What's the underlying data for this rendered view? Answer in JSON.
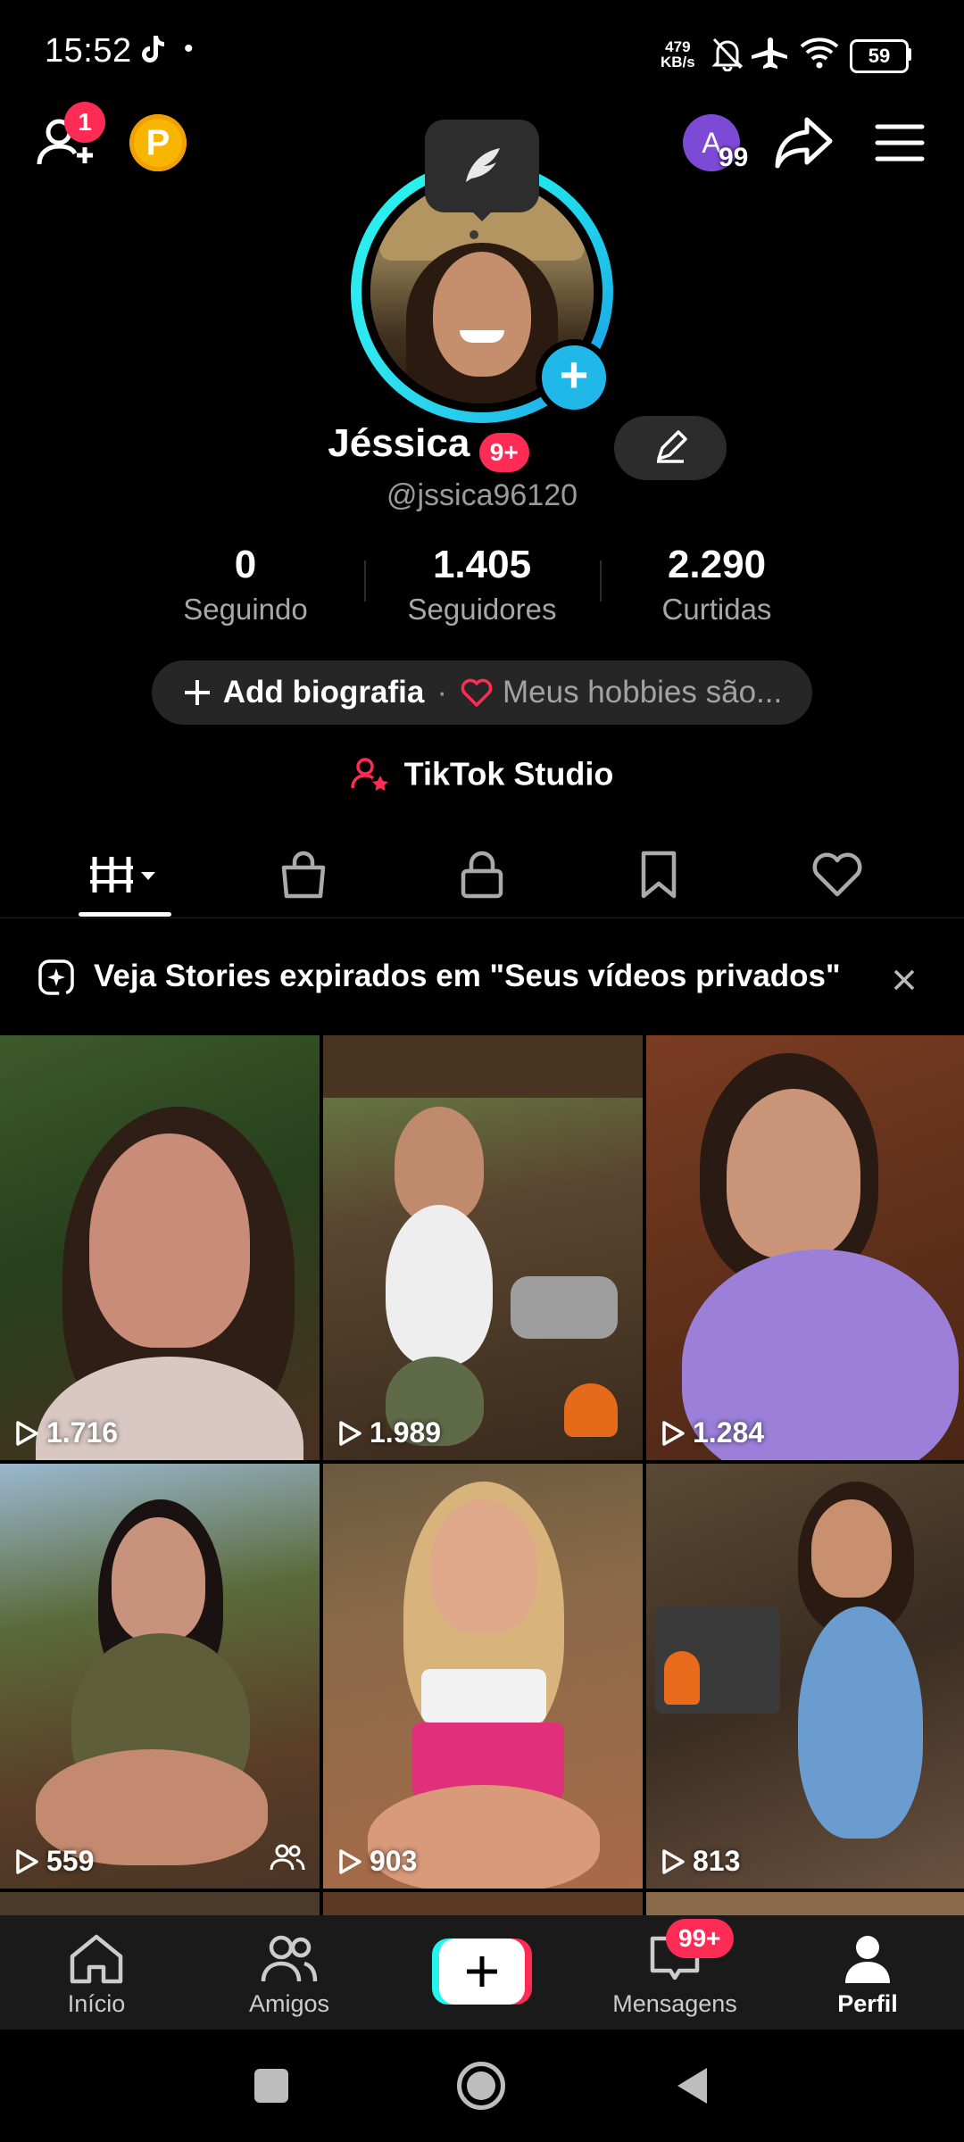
{
  "status_bar": {
    "time": "15:52",
    "net_speed_value": "479",
    "net_speed_unit": "KB/s",
    "battery": "59",
    "icons": [
      "tiktok-icon",
      "bell-muted-icon",
      "airplane-icon",
      "wifi-icon",
      "battery-icon"
    ]
  },
  "header": {
    "add_friends_badge": "1",
    "coin_label": "P",
    "account_initial": "A",
    "account_count": "99"
  },
  "profile": {
    "name": "Jéssica",
    "name_badge": "9+",
    "handle": "@jssica96120",
    "stats": [
      {
        "value": "0",
        "label": "Seguindo"
      },
      {
        "value": "1.405",
        "label": "Seguidores"
      },
      {
        "value": "2.290",
        "label": "Curtidas"
      }
    ],
    "bio_add": "Add biografia",
    "bio_hobby": "Meus hobbies são...",
    "studio": "TikTok Studio"
  },
  "tabs": [
    "videos-tab",
    "shop-tab",
    "private-tab",
    "saved-tab",
    "liked-tab"
  ],
  "banner": {
    "text": "Veja Stories expirados em \"Seus vídeos privados\""
  },
  "videos": [
    {
      "views": "1.716"
    },
    {
      "views": "1.989"
    },
    {
      "views": "1.284"
    },
    {
      "views": "559"
    },
    {
      "views": "903"
    },
    {
      "views": "813"
    }
  ],
  "bottom_nav": {
    "items": [
      {
        "label": "Início"
      },
      {
        "label": "Amigos"
      },
      {
        "label": "Mensagens"
      },
      {
        "label": "Perfil"
      }
    ],
    "messages_badge": "99+"
  },
  "colors": {
    "accent_red": "#fe2c55",
    "accent_cyan": "#25f4ee",
    "background": "#000000"
  }
}
